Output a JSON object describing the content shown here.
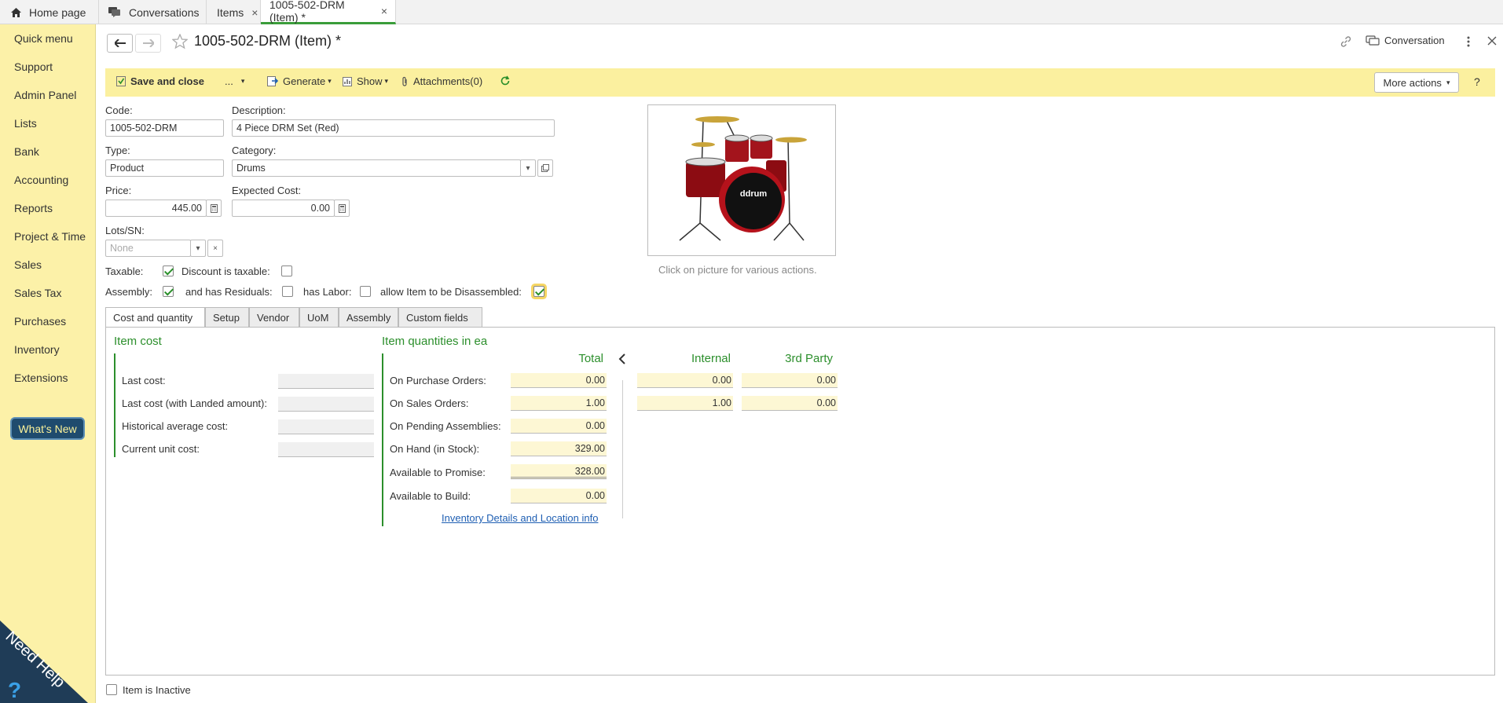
{
  "tabs": [
    {
      "label": "Home page",
      "icon": "home-icon"
    },
    {
      "label": "Conversations",
      "icon": "conversations-icon"
    },
    {
      "label": "Items",
      "close": "×"
    },
    {
      "label": "1005-502-DRM (Item) *",
      "close": "×"
    }
  ],
  "sidebar": {
    "items": [
      "Quick menu",
      "Support",
      "Admin Panel",
      "Lists",
      "Bank",
      "Accounting",
      "Reports",
      "Project & Time",
      "Sales",
      "Sales Tax",
      "Purchases",
      "Inventory",
      "Extensions"
    ],
    "whats_new": "What's New",
    "need_help": "Need Help"
  },
  "header": {
    "title": "1005-502-DRM (Item) *",
    "conversation": "Conversation"
  },
  "toolbar": {
    "save_close": "Save and close",
    "more_dots": "...",
    "generate": "Generate",
    "show": "Show",
    "attachments": "Attachments(0)",
    "more_actions": "More actions",
    "help": "?"
  },
  "form": {
    "code_label": "Code:",
    "code_value": "1005-502-DRM",
    "description_label": "Description:",
    "description_value": "4 Piece DRM Set (Red)",
    "type_label": "Type:",
    "type_value": "Product",
    "category_label": "Category:",
    "category_value": "Drums",
    "price_label": "Price:",
    "price_value": "445.00",
    "expected_cost_label": "Expected Cost:",
    "expected_cost_value": "0.00",
    "lots_label": "Lots/SN:",
    "lots_placeholder": "None",
    "taxable_label": "Taxable:",
    "discount_taxable_label": "Discount is taxable:",
    "assembly_label": "Assembly:",
    "has_residuals_label": "and has Residuals:",
    "has_labor_label": "has Labor:",
    "allow_disassemble_label": "allow Item to be Disassembled:",
    "taxable": true,
    "discount_taxable": false,
    "assembly": true,
    "has_residuals": false,
    "has_labor": false,
    "allow_disassemble": true,
    "picture_caption": "Click on picture for various actions.",
    "picture_brand": "ddrum"
  },
  "form_tabs": [
    "Cost and quantity",
    "Setup",
    "Vendor",
    "UoM",
    "Assembly",
    "Custom fields"
  ],
  "item_cost": {
    "title": "Item cost",
    "rows": [
      "Last cost:",
      "Last cost (with Landed amount):",
      "Historical average cost:",
      "Current unit cost:"
    ]
  },
  "item_quantities": {
    "title": "Item quantities in ea",
    "col_total": "Total",
    "col_internal": "Internal",
    "col_third": "3rd Party",
    "rows": [
      {
        "label": "On Purchase Orders:",
        "total": "0.00",
        "internal": "0.00",
        "third": "0.00"
      },
      {
        "label": "On Sales Orders:",
        "total": "1.00",
        "internal": "1.00",
        "third": "0.00"
      },
      {
        "label": "On Pending Assemblies:",
        "total": "0.00"
      },
      {
        "label": "On Hand (in Stock):",
        "total": "329.00"
      },
      {
        "label": "Available to Promise:",
        "total": "328.00"
      },
      {
        "label": "Available to Build:",
        "total": "0.00"
      }
    ],
    "details_link": "Inventory Details and Location info"
  },
  "footer": {
    "inactive_label": "Item is Inactive",
    "inactive": false
  }
}
